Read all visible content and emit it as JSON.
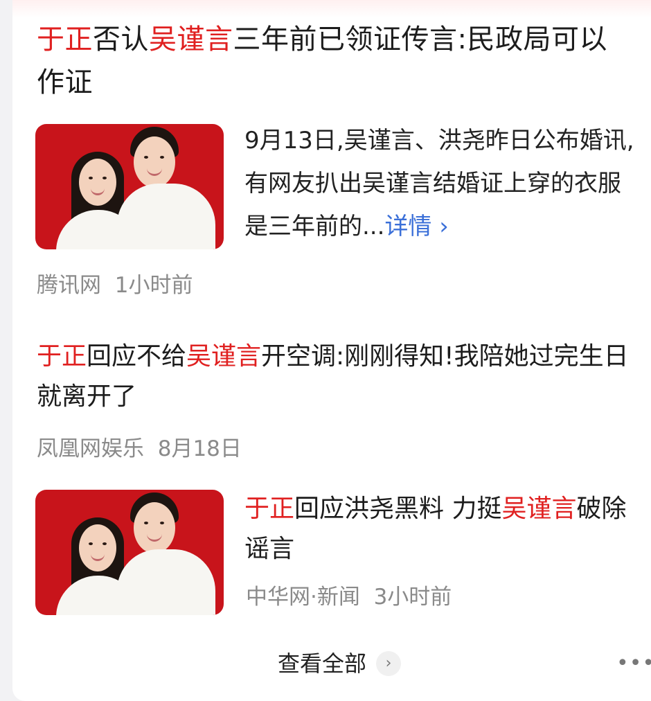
{
  "articles": [
    {
      "title_parts": [
        "于正",
        "否认",
        "吴谨言",
        "三年前已领证传言:民政局可以作证"
      ],
      "summary": "9月13日,吴谨言、洪尧昨日公布婚讯,有网友扒出吴谨言结婚证上穿的衣服是三年前的...",
      "more_label": "详情",
      "more_icon": "chevron-right-icon",
      "source": "腾讯网",
      "time": "1小时前"
    },
    {
      "title_parts": [
        "于正",
        "回应不给",
        "吴谨言",
        "开空调:刚刚得知!我陪她过完生日就离开了"
      ],
      "source": "凤凰网娱乐",
      "time": "8月18日"
    },
    {
      "title_parts": [
        "于正",
        "回应洪尧黑料 力挺",
        "吴谨言",
        "破除谣言"
      ],
      "source": "中华网·新闻",
      "time": "3小时前"
    }
  ],
  "footer": {
    "view_all_label": "查看全部",
    "view_all_icon": "chevron-right-icon",
    "more_icon": "more-dots-icon",
    "more_glyph": "•••"
  },
  "colors": {
    "highlight": "#e02020",
    "link": "#3a6fd8",
    "meta": "#8a8a8a",
    "thumb_bg": "#c8141b"
  }
}
